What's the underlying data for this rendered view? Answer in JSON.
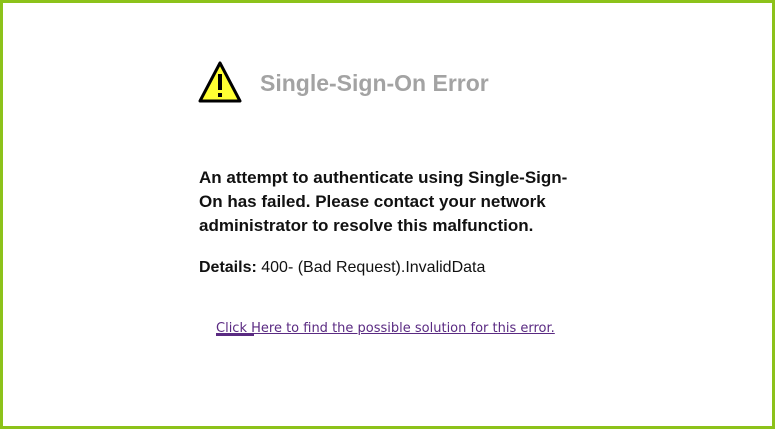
{
  "error": {
    "icon": "warning-icon",
    "title": "Single-Sign-On Error",
    "message": "An attempt to authenticate using Single-Sign-On has failed. Please contact your network administrator to resolve this malfunction.",
    "details_label": "Details:",
    "details_value": "400- (Bad Request).InvalidData",
    "solution_link": "Click Here to find the possible solution for this error."
  },
  "colors": {
    "frame_border": "#8cc21a",
    "title": "#a3a3a3",
    "warning_fill": "#ffff33",
    "link": "#5a2a82"
  }
}
